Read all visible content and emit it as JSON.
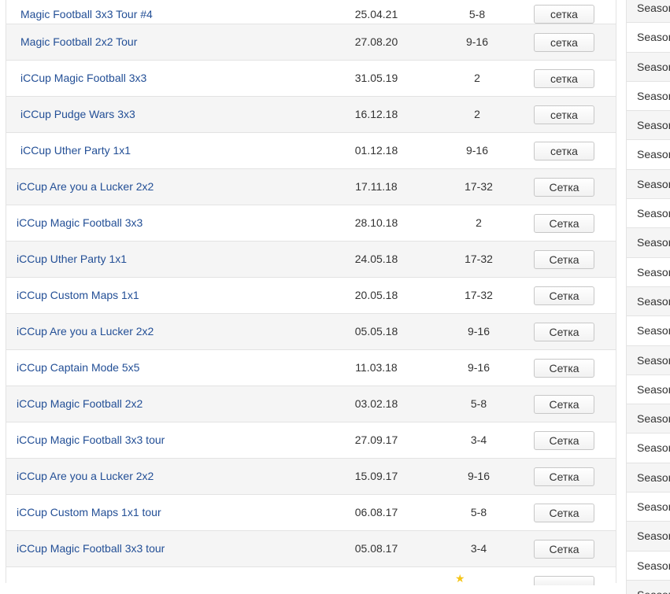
{
  "tournaments": [
    {
      "name": "Magic Football 3x3 Tour #4",
      "date": "25.04.21",
      "place": "5-8",
      "grid": "сетка"
    },
    {
      "name": "Magic Football 2x2 Tour",
      "date": "27.08.20",
      "place": "9-16",
      "grid": "сетка"
    },
    {
      "name": "iCCup Magic Football 3x3",
      "date": "31.05.19",
      "place": "2",
      "grid": "сетка"
    },
    {
      "name": "iCCup Pudge Wars 3x3",
      "date": "16.12.18",
      "place": "2",
      "grid": "сетка"
    },
    {
      "name": "iCCup Uther Party 1x1",
      "date": "01.12.18",
      "place": "9-16",
      "grid": "сетка"
    },
    {
      "name": "iCCup Are you a Lucker 2x2",
      "date": "17.11.18",
      "place": "17-32",
      "grid": "Сетка"
    },
    {
      "name": "iCCup Magic Football 3x3",
      "date": "28.10.18",
      "place": "2",
      "grid": "Сетка"
    },
    {
      "name": "iCCup Uther Party 1x1",
      "date": "24.05.18",
      "place": "17-32",
      "grid": "Сетка"
    },
    {
      "name": "iCCup Custom Maps 1x1",
      "date": "20.05.18",
      "place": "17-32",
      "grid": "Сетка"
    },
    {
      "name": "iCCup Are you a Lucker 2x2",
      "date": "05.05.18",
      "place": "9-16",
      "grid": "Сетка"
    },
    {
      "name": "iCCup Captain Mode 5x5",
      "date": "11.03.18",
      "place": "9-16",
      "grid": "Сетка"
    },
    {
      "name": "iCCup Magic Football 2x2",
      "date": "03.02.18",
      "place": "5-8",
      "grid": "Сетка"
    },
    {
      "name": "iCCup Magic Football 3x3 tour",
      "date": "27.09.17",
      "place": "3-4",
      "grid": "Сетка"
    },
    {
      "name": "iCCup Are you a Lucker 2x2",
      "date": "15.09.17",
      "place": "9-16",
      "grid": "Сетка"
    },
    {
      "name": "iCCup Custom Maps 1x1 tour",
      "date": "06.08.17",
      "place": "5-8",
      "grid": "Сетка"
    },
    {
      "name": "iCCup Magic Football 3x3 tour",
      "date": "05.08.17",
      "place": "3-4",
      "grid": "Сетка"
    }
  ],
  "partial_row": {
    "icon": "star-icon",
    "icon_color": "#f5c518"
  },
  "seasons": {
    "label": "Season",
    "count": 21
  },
  "colors": {
    "link": "#234f96",
    "row_alt": "#f5f5f5",
    "border": "#e3e3e3"
  }
}
